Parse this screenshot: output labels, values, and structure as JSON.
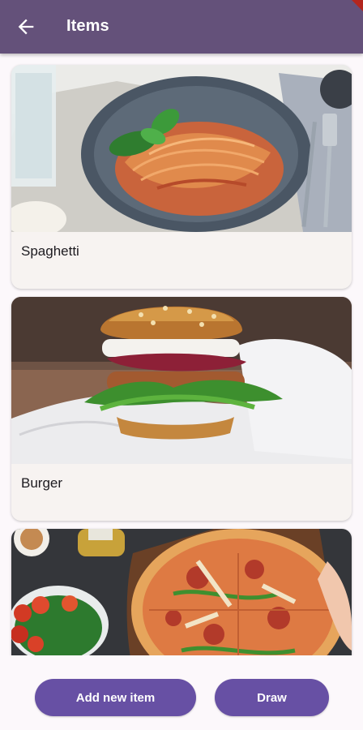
{
  "app_bar": {
    "title": "Items",
    "back_icon": "arrow-back-icon"
  },
  "items": [
    {
      "name": "Spaghetti",
      "image": "spaghetti-photo"
    },
    {
      "name": "Burger",
      "image": "burger-photo"
    },
    {
      "name": "",
      "image": "pizza-photo"
    }
  ],
  "actions": {
    "add_label": "Add new item",
    "draw_label": "Draw"
  },
  "colors": {
    "app_bar": "#64517a",
    "primary_button": "#6750a4",
    "card": "#f7f3f1",
    "background": "#fcf8fb"
  }
}
